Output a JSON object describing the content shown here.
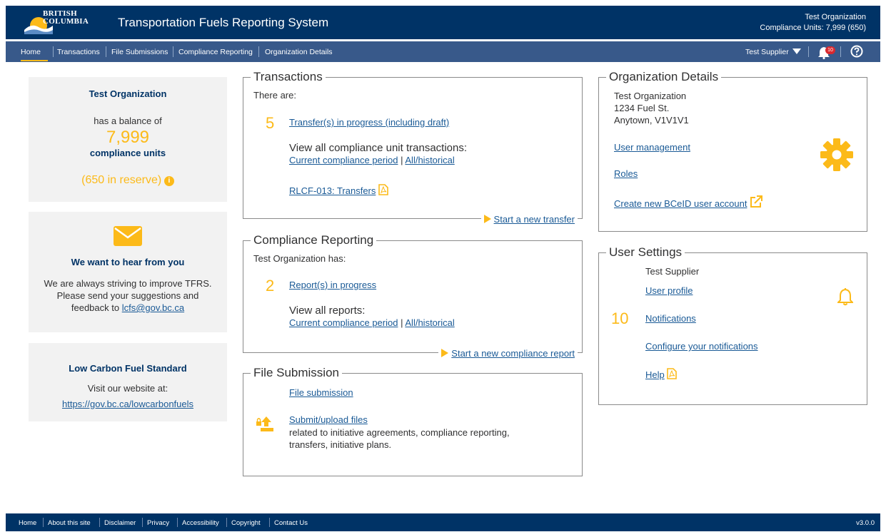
{
  "header": {
    "logo_line1": "BRITISH",
    "logo_line2": "COLUMBIA",
    "title": "Transportation Fuels Reporting System",
    "org_name": "Test Organization",
    "compliance_units": "Compliance Units: 7,999 (650)"
  },
  "nav": {
    "items": [
      "Home",
      "Transactions",
      "File Submissions",
      "Compliance Reporting",
      "Organization Details"
    ],
    "user": "Test Supplier",
    "notification_count": "10",
    "help_icon": "help-circle-icon"
  },
  "balance_card": {
    "org": "Test Organization",
    "has_balance": "has a balance of",
    "balance": "7,999",
    "units": "compliance units",
    "reserve": "(650 in reserve)"
  },
  "feedback_card": {
    "title": "We want to hear from you",
    "line1": "We are always striving to improve TFRS.",
    "line2": "Please send your suggestions and",
    "line3": "feedback to",
    "email": "lcfs@gov.bc.ca"
  },
  "lcfs_card": {
    "title": "Low Carbon Fuel Standard",
    "visit": "Visit our website at:",
    "url": "https://gov.bc.ca/lowcarbonfuels"
  },
  "transactions": {
    "legend": "Transactions",
    "intro": "There are:",
    "count": "5",
    "in_progress": "Transfer(s) in progress (including draft)",
    "view_all": "View all compliance unit transactions:",
    "current": "Current compliance period",
    "sep": "|",
    "historical": "All/historical",
    "rlcf": "RLCF-013: Transfers",
    "start": "Start a new transfer"
  },
  "compliance": {
    "legend": "Compliance Reporting",
    "intro": "Test Organization has:",
    "count": "2",
    "in_progress": "Report(s) in progress",
    "view_all": "View all reports:",
    "current": "Current compliance period",
    "sep": "|",
    "historical": "All/historical",
    "start": "Start a new compliance report"
  },
  "file_submission": {
    "legend": "File Submission",
    "link": "File submission",
    "upload": "Submit/upload files",
    "desc1": "related to initiative agreements, compliance reporting,",
    "desc2": "transfers, initiative plans."
  },
  "org_details": {
    "legend": "Organization Details",
    "name": "Test Organization",
    "street": "1234 Fuel St.",
    "city": "Anytown, V1V1V1",
    "user_mgmt": "User management",
    "roles": "Roles",
    "create": "Create new BCeID user account"
  },
  "user_settings": {
    "legend": "User Settings",
    "name": "Test Supplier",
    "profile": "User profile",
    "count": "10",
    "notifications": "Notifications",
    "configure": "Configure your notifications",
    "help": "Help"
  },
  "footer": {
    "items": [
      "Home",
      "About this site",
      "Disclaimer",
      "Privacy",
      "Accessibility",
      "Copyright",
      "Contact Us"
    ],
    "version": "v3.0.0"
  },
  "colors": {
    "header": "#003366",
    "nav": "#38598a",
    "accent": "#fcba19",
    "link": "#1a5a96"
  }
}
